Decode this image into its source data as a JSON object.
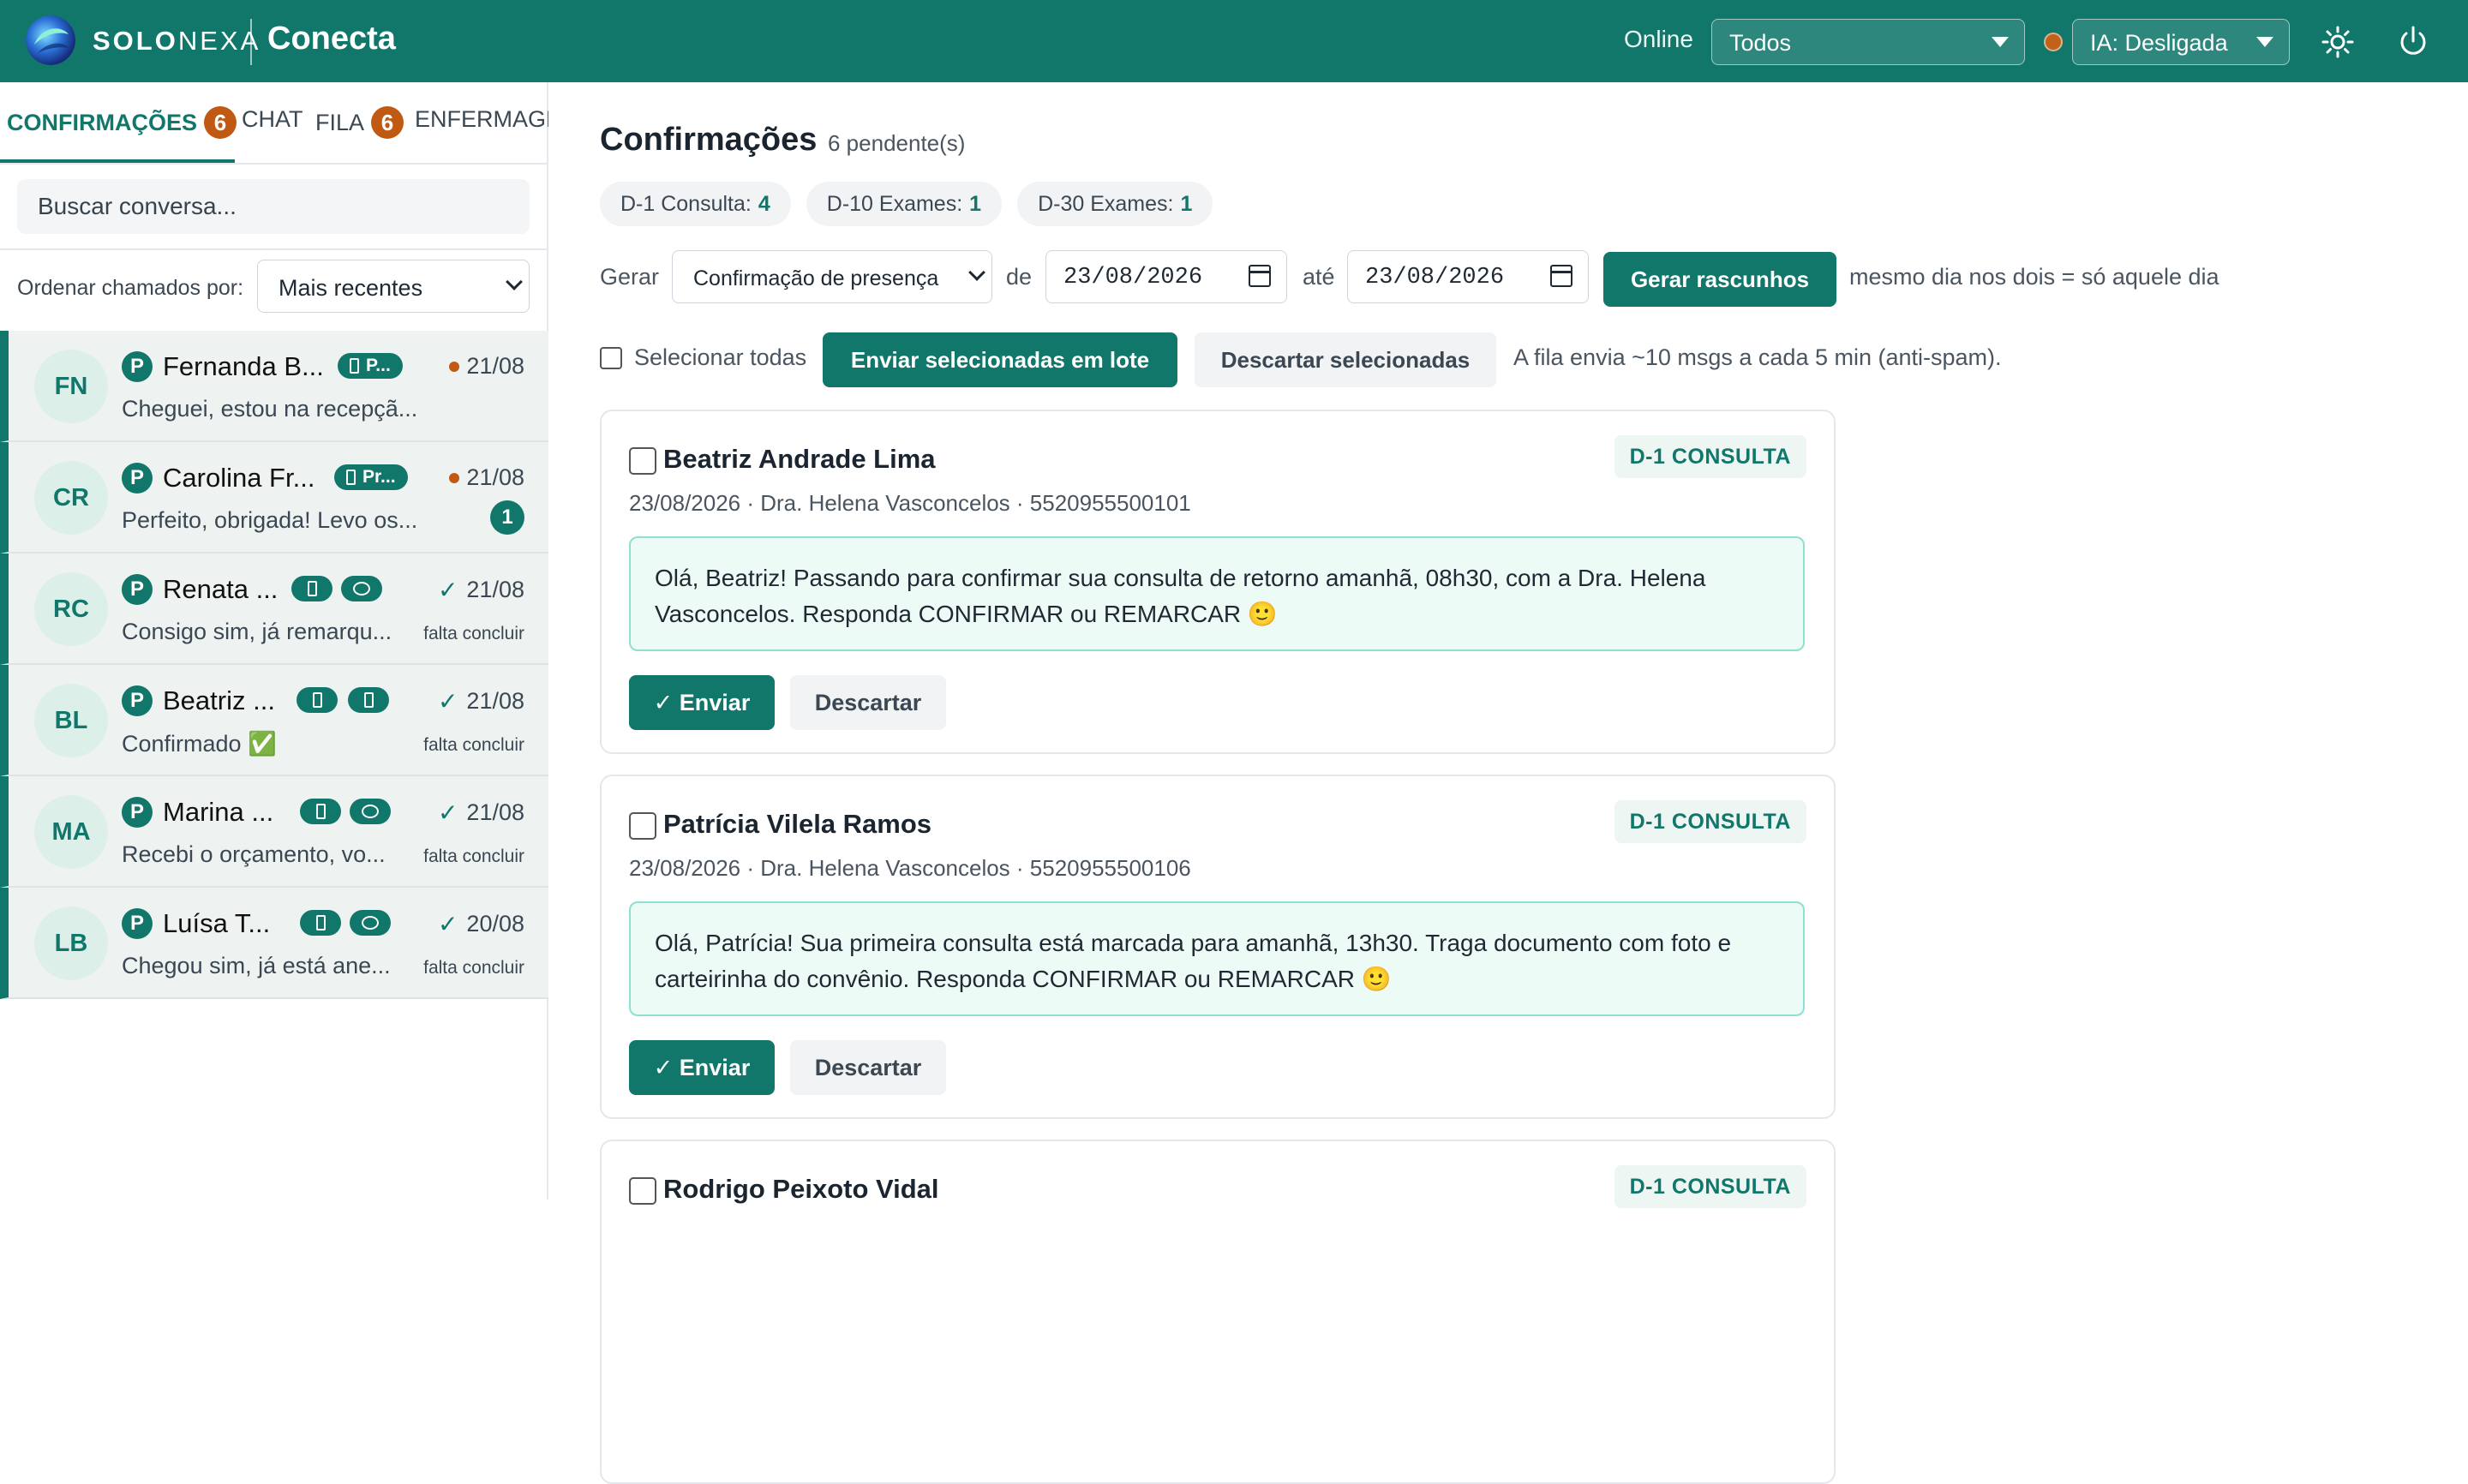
{
  "topbar": {
    "brand_bold": "SOLO",
    "brand_thin": "NEXA",
    "app_name": "Conecta",
    "online_label": "Online",
    "online_filter": "Todos",
    "ia_status": "IA: Desligada",
    "ia_dot_color": "#c0621a",
    "icons": [
      "theme-toggle-icon",
      "power-icon"
    ]
  },
  "sidebar": {
    "tabs": [
      {
        "label": "CONFIRMAÇÕES",
        "badge": "6",
        "active": true
      },
      {
        "label": "CHAT"
      },
      {
        "label": "FILA",
        "badge": "6"
      },
      {
        "label": "ENFERMAGE"
      }
    ],
    "search_placeholder": "Buscar conversa...",
    "order_label": "Ordenar chamados por:",
    "order_value": "Mais recentes",
    "conversations": [
      {
        "initials": "FN",
        "p": "P",
        "name": "Fernanda B...",
        "pill": "P...",
        "date": "21/08",
        "dot": true,
        "preview": "Cheguei, estou na recepçã..."
      },
      {
        "initials": "CR",
        "p": "P",
        "name": "Carolina Fr...",
        "pill": "Pr...",
        "date": "21/08",
        "dot": true,
        "preview": "Perfeito, obrigada! Levo os...",
        "unread": "1"
      },
      {
        "initials": "RC",
        "p": "P",
        "name": "Renata ...",
        "date": "21/08",
        "check": "✓",
        "preview": "Consigo sim, já remarqu...",
        "status": "falta concluir"
      },
      {
        "initials": "BL",
        "p": "P",
        "name": "Beatriz ...",
        "date": "21/08",
        "check": "✓",
        "preview": "Confirmado ✅",
        "status": "falta concluir"
      },
      {
        "initials": "MA",
        "p": "P",
        "name": "Marina ...",
        "date": "21/08",
        "check": "✓",
        "preview": "Recebi o orçamento, vo...",
        "status": "falta concluir"
      },
      {
        "initials": "LB",
        "p": "P",
        "name": "Luísa T...",
        "date": "20/08",
        "check": "✓",
        "preview": "Chegou sim, já está ane...",
        "status": "falta concluir"
      }
    ]
  },
  "main": {
    "title": "Confirmações",
    "pending": "6 pendente(s)",
    "chips": [
      {
        "label": "D-1 Consulta:",
        "count": "4"
      },
      {
        "label": "D-10 Exames:",
        "count": "1"
      },
      {
        "label": "D-30 Exames:",
        "count": "1"
      }
    ],
    "generate": {
      "label": "Gerar",
      "type": "Confirmação de presença",
      "from_label": "de",
      "from_date": "23/08/2026",
      "to_label": "até",
      "to_date": "23/08/2026",
      "button": "Gerar rascunhos",
      "hint": "mesmo dia nos dois = só aquele dia"
    },
    "batch": {
      "select_all": "Selecionar todas",
      "send_batch": "Enviar selecionadas em lote",
      "discard_selected": "Descartar selecionadas",
      "hint": "A fila envia ~10 msgs a cada 5 min (anti-spam)."
    },
    "cards": [
      {
        "name": "Beatriz Andrade Lima",
        "tag": "D-1 CONSULTA",
        "meta": "23/08/2026 · Dra. Helena Vasconcelos · 5520955500101",
        "message": "Olá, Beatriz! Passando para confirmar sua consulta de retorno amanhã, 08h30, com a Dra. Helena Vasconcelos. Responda CONFIRMAR ou REMARCAR 🙂",
        "send": "✓ Enviar",
        "discard": "Descartar"
      },
      {
        "name": "Patrícia Vilela Ramos",
        "tag": "D-1 CONSULTA",
        "meta": "23/08/2026 · Dra. Helena Vasconcelos · 5520955500106",
        "message": "Olá, Patrícia! Sua primeira consulta está marcada para amanhã, 13h30. Traga documento com foto e carteirinha do convênio. Responda CONFIRMAR ou REMARCAR 🙂",
        "send": "✓ Enviar",
        "discard": "Descartar"
      },
      {
        "name": "Rodrigo Peixoto Vidal",
        "tag": "D-1 CONSULTA"
      }
    ]
  },
  "colors": {
    "accent": "#11776b",
    "badge": "#c05a13",
    "msg_bg": "#edfbf7"
  }
}
